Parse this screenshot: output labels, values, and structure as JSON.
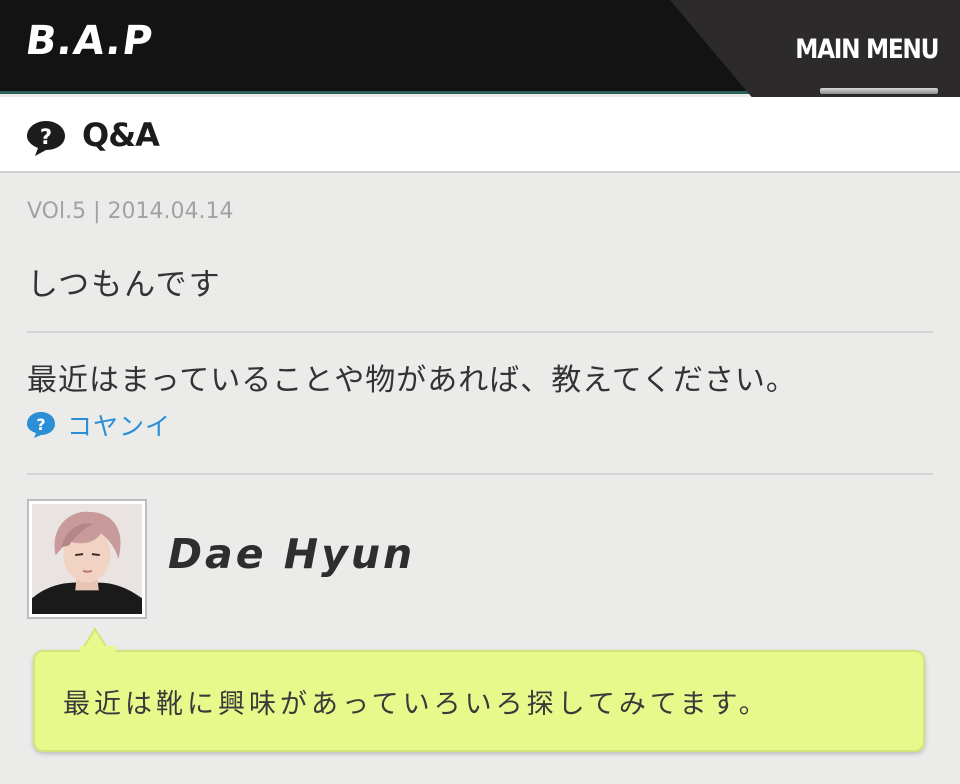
{
  "header": {
    "logo": "B.A.P",
    "menu_label": "MAIN MENU",
    "menu_icon": "hamburger-icon"
  },
  "section": {
    "icon": "question-bubble-icon",
    "title": "Q&A"
  },
  "post": {
    "meta": "VOl.5 | 2014.04.14",
    "title": "しつもんです",
    "question": "最近はまっていることや物があれば、教えてください。",
    "asker_icon": "question-circle-icon",
    "asker": "コヤンイ"
  },
  "answer": {
    "member_name": "Dae Hyun",
    "text": "最近は靴に興味があっていろいろ探してみてます。"
  },
  "colors": {
    "header_bg": "#141313",
    "page_bg": "#ebebea",
    "link": "#2b8fd6",
    "bubble_bg": "#e8f98c"
  }
}
